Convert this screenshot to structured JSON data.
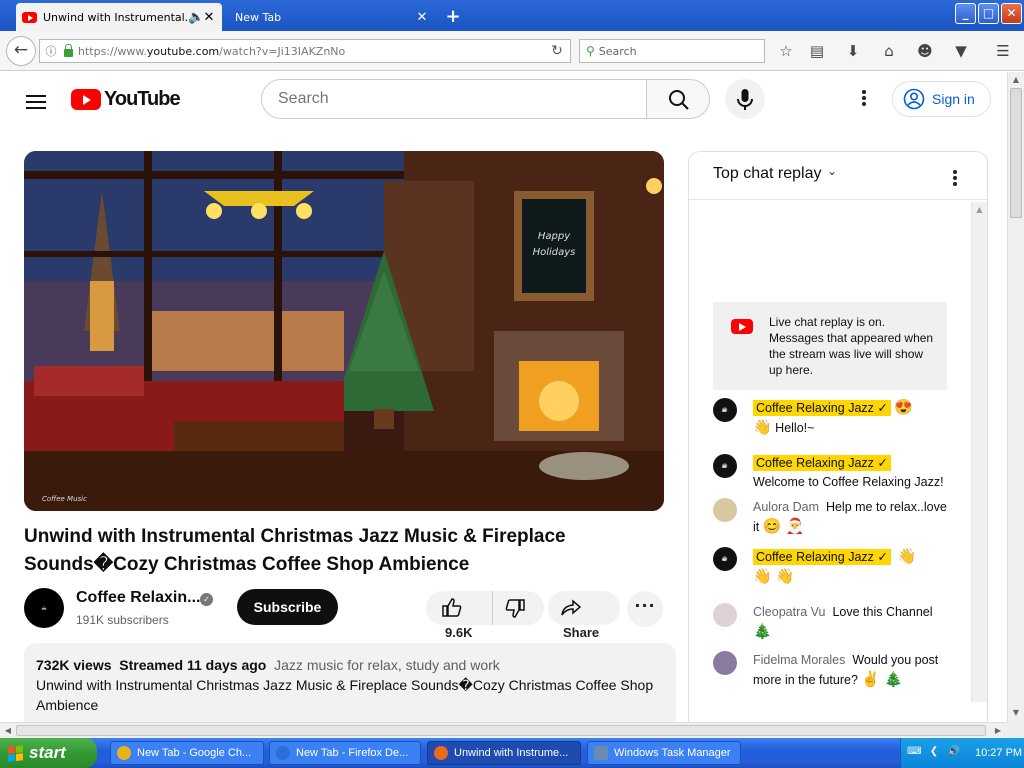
{
  "browser": {
    "tabs": [
      {
        "label": "Unwind with Instrumental...",
        "active": true
      },
      {
        "label": "New Tab",
        "active": false
      }
    ],
    "url_prefix": "https://www.",
    "url_domain": "youtube.com",
    "url_path": "/watch?v=Ji13IAKZnNo",
    "search_placeholder": "Search"
  },
  "youtube": {
    "logo_text": "YouTube",
    "search_placeholder": "Search",
    "signin_label": "Sign in",
    "video": {
      "title": "Unwind with Instrumental Christmas Jazz Music & Fireplace Sounds Cozy Christmas Coffee Shop Ambience",
      "title_line1": "Unwind with Instrumental Christmas Jazz Music & Fireplace",
      "title_line2": "Sounds�Cozy Christmas Coffee Shop Ambience",
      "channel_name": "Coffee Relaxin...",
      "subscribers": "191K subscribers",
      "subscribe_label": "Subscribe",
      "likes": "9.6K",
      "share_label": "Share",
      "views": "732K views",
      "streamed": "Streamed 11 days ago",
      "tags": "Jazz music for relax, study and work",
      "description": "Unwind with Instrumental Christmas Jazz Music & Fireplace Sounds�Cozy Christmas Coffee Shop Ambience",
      "thumb_sign_1": "Happy",
      "thumb_sign_2": "Holidays",
      "thumb_watermark": "Coffee Music"
    },
    "chat": {
      "title": "Top chat replay",
      "notice": "Live chat replay is on. Messages that appeared when the stream was live will show up here.",
      "messages": [
        {
          "author": "Coffee Relaxing Jazz ✓",
          "owner": true,
          "text": "Hello!~",
          "emoji_pre": "😍",
          "emoji_hand": "👋"
        },
        {
          "author": "Coffee Relaxing Jazz ✓",
          "owner": true,
          "text": "Welcome to Coffee Relaxing Jazz!"
        },
        {
          "author": "Aulora Dam",
          "owner": false,
          "text": "Help me to relax..love it",
          "emoji": "😊 🎅"
        },
        {
          "author": "Coffee Relaxing Jazz ✓",
          "owner": true,
          "text": "",
          "emoji": "👋",
          "emoji2": "👋 👋"
        },
        {
          "author": "Cleopatra Vu",
          "owner": false,
          "text": "Love this Channel",
          "emoji": "🎄"
        },
        {
          "author": "Fidelma Morales",
          "owner": false,
          "text": "Would you post more in the future?",
          "emoji": "✌️ 🎄"
        }
      ]
    }
  },
  "taskbar": {
    "start_label": "start",
    "tasks": [
      {
        "label": "New Tab - Google Ch...",
        "color": "#e8b21a"
      },
      {
        "label": "New Tab - Firefox De...",
        "color": "#2a6ed8"
      },
      {
        "label": "Unwind with Instrume...",
        "color": "#e86a1a"
      },
      {
        "label": "Windows Task Manager",
        "color": "#6a8ab0"
      }
    ],
    "clock": "10:27 PM"
  },
  "colors": {
    "yt_red": "#ff0000",
    "owner_badge": "#ffd600",
    "signin_blue": "#065fd4",
    "xp_blue": "#245edb",
    "start_green": "#339933"
  }
}
